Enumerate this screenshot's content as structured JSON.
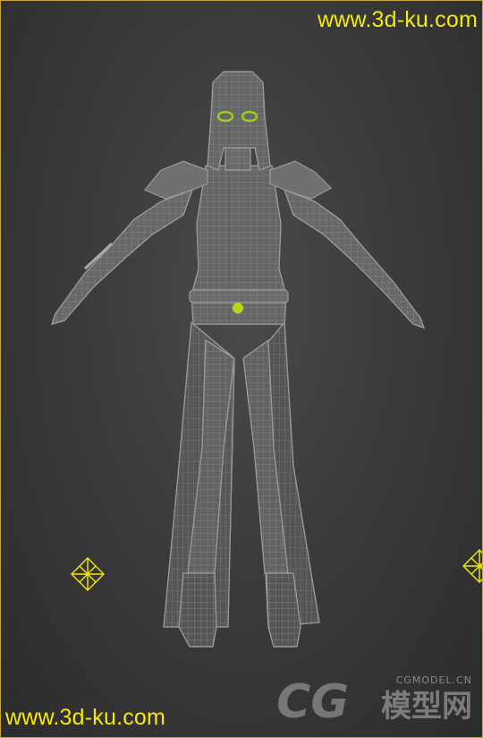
{
  "viewport": {
    "name": "3d-viewport",
    "border_color": "#c9a63a",
    "background": "#3b3b3b"
  },
  "watermarks": {
    "top_url": "www.3d-ku.com",
    "bottom_url": "www.3d-ku.com",
    "cg_site": "CGMODEL.CN",
    "cg_logo_text": "CG",
    "cg_logo_cn": "模型网",
    "color": "#f5e90a"
  },
  "model": {
    "wire_color": "#8c8c8c",
    "selection_color": "#9ccc1a"
  },
  "helpers": {
    "color": "#f5e90a",
    "icon": "light-helper-icon"
  }
}
